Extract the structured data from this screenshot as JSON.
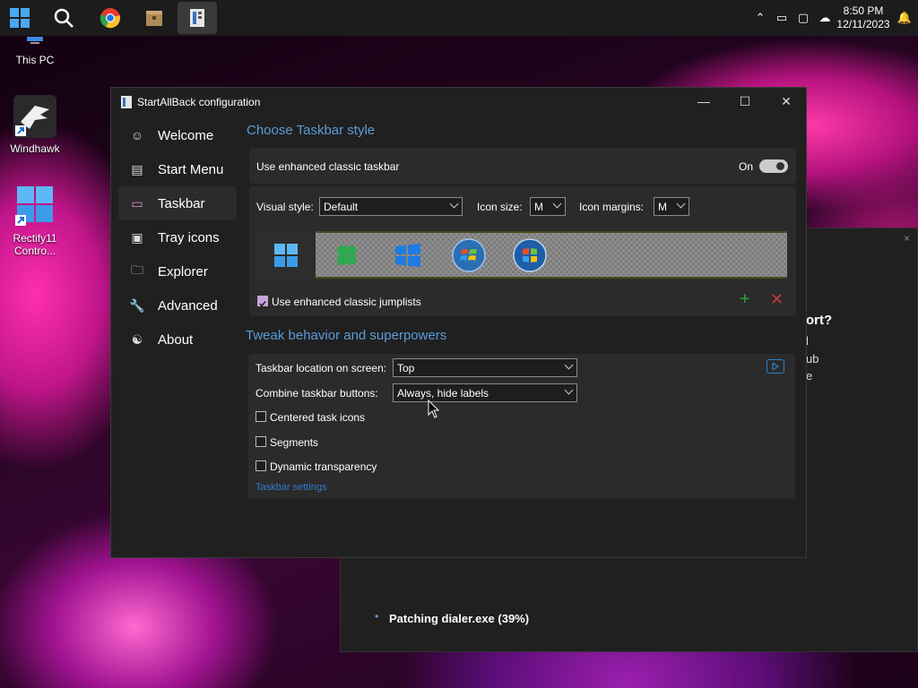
{
  "taskbar": {
    "clock_time": "8:50 PM",
    "clock_date": "12/11/2023",
    "icons": [
      "start-icon",
      "search-icon",
      "chrome-icon",
      "package-icon",
      "startallback-icon"
    ]
  },
  "desktop": {
    "icons": [
      {
        "label": "This PC"
      },
      {
        "label": "Windhawk"
      },
      {
        "label": "Rectify11 Contro..."
      }
    ]
  },
  "window": {
    "title": "StartAllBack configuration",
    "nav": [
      {
        "label": "Welcome",
        "icon": "smile-icon"
      },
      {
        "label": "Start Menu",
        "icon": "start-menu-icon"
      },
      {
        "label": "Taskbar",
        "icon": "taskbar-icon"
      },
      {
        "label": "Tray icons",
        "icon": "tray-icon"
      },
      {
        "label": "Explorer",
        "icon": "folder-icon"
      },
      {
        "label": "Advanced",
        "icon": "wrench-icon"
      },
      {
        "label": "About",
        "icon": "about-icon"
      }
    ],
    "active_nav": "Taskbar",
    "style_section": {
      "title": "Choose Taskbar style",
      "enhanced_label": "Use enhanced classic taskbar",
      "toggle_state": "On",
      "visual_style_label": "Visual style:",
      "visual_style_value": "Default",
      "icon_size_label": "Icon size:",
      "icon_size_value": "M",
      "icon_margins_label": "Icon margins:",
      "icon_margins_value": "M",
      "jumplists_label": "Use enhanced classic jumplists",
      "jumplists_checked": true
    },
    "behavior_section": {
      "title": "Tweak behavior and superpowers",
      "location_label": "Taskbar location on screen:",
      "location_value": "Top",
      "combine_label": "Combine taskbar buttons:",
      "combine_value": "Always, hide labels",
      "centered_label": "Centered task icons",
      "segments_label": "Segments",
      "dynamic_label": "Dynamic transparency",
      "settings_link": "Taskbar settings"
    }
  },
  "back_window": {
    "partial_heading": "ort?",
    "partial_lines": [
      "l",
      "ub",
      "e"
    ],
    "status": "Patching dialer.exe (39%)"
  },
  "colors": {
    "accent": "#5b9bd8",
    "link": "#2d7fd1",
    "checkbox": "#c6a3d9",
    "plus": "#2fa52f",
    "remove": "#c23b3b"
  }
}
